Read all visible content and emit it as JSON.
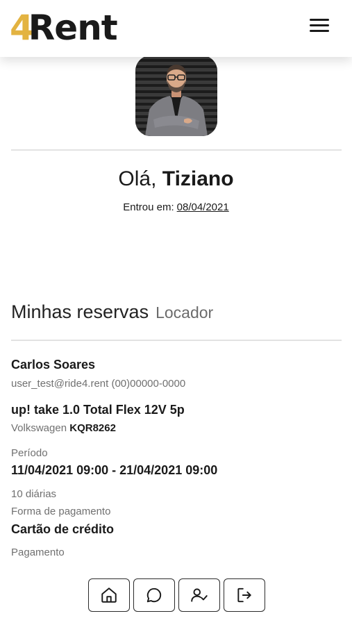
{
  "header": {
    "logo_accent": "4",
    "logo_text": "Rent",
    "menu_icon": "hamburger-menu-icon"
  },
  "profile": {
    "greeting_prefix": "Olá, ",
    "user_name": "Tiziano",
    "joined_label": "Entrou em:",
    "joined_date": "08/04/2021"
  },
  "reservations": {
    "title": "Minhas reservas",
    "role": "Locador",
    "items": [
      {
        "renter_name": "Carlos Soares",
        "contact": "user_test@ride4.rent (00)00000-0000",
        "car_model": "up! take 1.0 Total Flex 12V 5p",
        "car_brand": "Volkswagen",
        "plate": "KQR8262",
        "period_label": "Período",
        "period": "11/04/2021 09:00 - 21/04/2021 09:00",
        "days": "10 diárias",
        "payment_method_label": "Forma de pagamento",
        "payment_method": "Cartão de crédito",
        "payment_label": "Pagamento"
      }
    ]
  },
  "bottom_nav": [
    {
      "icon": "home-icon"
    },
    {
      "icon": "chat-bubble-icon"
    },
    {
      "icon": "user-check-icon"
    },
    {
      "icon": "logout-icon"
    }
  ],
  "colors": {
    "brand_gold": "#e3b341",
    "text_dark": "#1a1a1a",
    "text_muted": "#707070",
    "divider": "#e2e2e2"
  }
}
